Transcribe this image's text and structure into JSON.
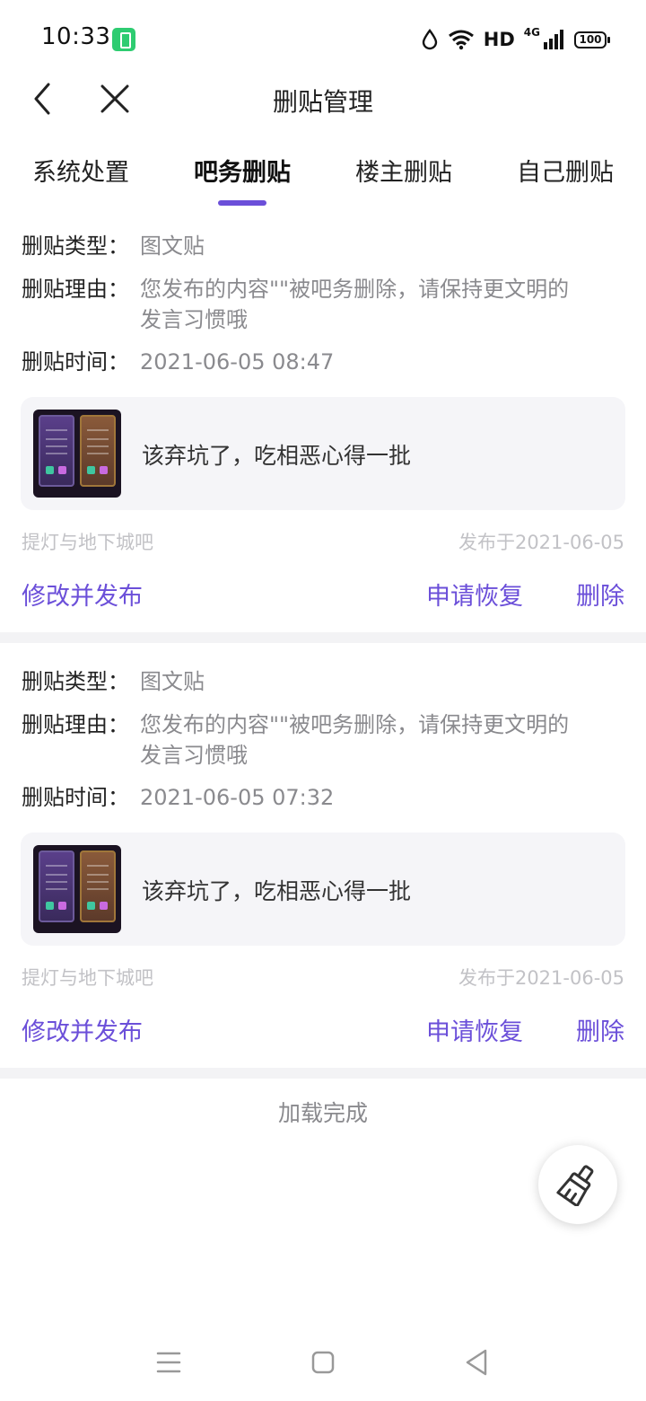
{
  "status_bar": {
    "time": "10:33",
    "network_label": "HD",
    "network_type": "4G",
    "battery": "100"
  },
  "nav": {
    "title": "删贴管理"
  },
  "tabs": [
    {
      "label": "系统处置",
      "active": false
    },
    {
      "label": "吧务删贴",
      "active": true
    },
    {
      "label": "楼主删贴",
      "active": false
    },
    {
      "label": "自己删贴",
      "active": false
    }
  ],
  "labels": {
    "type": "删贴类型：",
    "reason": "删贴理由：",
    "time": "删贴时间：",
    "edit_publish": "修改并发布",
    "request_restore": "申请恢复",
    "delete": "删除"
  },
  "records": [
    {
      "type": "图文贴",
      "reason_line1": "您发布的内容\"\"被吧务删除，请保持更文明的",
      "reason_line2": "发言习惯哦",
      "time": "2021-06-05 08:47",
      "post_text": "该弃坑了，吃相恶心得一批",
      "forum": "提灯与地下城吧",
      "published": "发布于2021-06-05"
    },
    {
      "type": "图文贴",
      "reason_line1": "您发布的内容\"\"被吧务删除，请保持更文明的",
      "reason_line2": "发言习惯哦",
      "time": "2021-06-05 07:32",
      "post_text": "该弃坑了，吃相恶心得一批",
      "forum": "提灯与地下城吧",
      "published": "发布于2021-06-05"
    }
  ],
  "footer": {
    "load_status": "加载完成"
  },
  "icons": {
    "back": "chevron-left-icon",
    "close": "close-icon",
    "fab": "broom-icon",
    "sys_menu": "menu-icon",
    "sys_home": "home-square-icon",
    "sys_back": "triangle-back-icon"
  },
  "colors": {
    "accent": "#6b4fd9",
    "secondary_text": "#8a8a8e",
    "muted_text": "#c2c2c6",
    "post_box_bg": "#f5f5f8"
  }
}
